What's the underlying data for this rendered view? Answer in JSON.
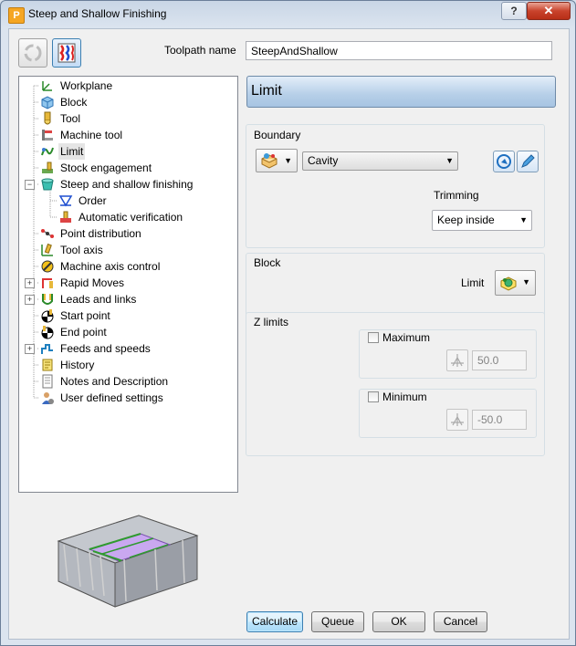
{
  "window": {
    "title": "Steep and Shallow Finishing",
    "help_label": "?",
    "close_label": "✕",
    "app_icon_letter": "P"
  },
  "header": {
    "toolpath_name_label": "Toolpath name",
    "toolpath_name_value": "SteepAndShallow"
  },
  "tree": {
    "items": [
      {
        "label": "Workplane",
        "icon": "workplane-icon"
      },
      {
        "label": "Block",
        "icon": "block-icon"
      },
      {
        "label": "Tool",
        "icon": "tool-icon"
      },
      {
        "label": "Machine tool",
        "icon": "machine-tool-icon"
      },
      {
        "label": "Limit",
        "icon": "limit-icon",
        "selected": true
      },
      {
        "label": "Stock engagement",
        "icon": "stock-engagement-icon"
      },
      {
        "label": "Steep and shallow finishing",
        "icon": "steep-shallow-icon",
        "expanded": true
      },
      {
        "label": "Order",
        "icon": "order-icon",
        "child": true
      },
      {
        "label": "Automatic verification",
        "icon": "verification-icon",
        "child": true
      },
      {
        "label": "Point distribution",
        "icon": "point-distribution-icon"
      },
      {
        "label": "Tool axis",
        "icon": "tool-axis-icon"
      },
      {
        "label": "Machine axis control",
        "icon": "machine-axis-icon"
      },
      {
        "label": "Rapid Moves",
        "icon": "rapid-moves-icon",
        "collapsed": true
      },
      {
        "label": "Leads and links",
        "icon": "leads-links-icon",
        "collapsed": true
      },
      {
        "label": "Start point",
        "icon": "start-point-icon"
      },
      {
        "label": "End point",
        "icon": "end-point-icon"
      },
      {
        "label": "Feeds and speeds",
        "icon": "feeds-speeds-icon",
        "collapsed": true
      },
      {
        "label": "History",
        "icon": "history-icon"
      },
      {
        "label": "Notes and Description",
        "icon": "notes-icon"
      },
      {
        "label": "User defined settings",
        "icon": "user-settings-icon"
      }
    ]
  },
  "panel": {
    "title": "Limit",
    "boundary": {
      "title": "Boundary",
      "selected": "Cavity",
      "trimming_label": "Trimming",
      "trimming_value": "Keep inside"
    },
    "block": {
      "title": "Block",
      "limit_label": "Limit"
    },
    "zlimits": {
      "title": "Z limits",
      "maximum_label": "Maximum",
      "maximum_value": "50.0",
      "minimum_label": "Minimum",
      "minimum_value": "-50.0"
    }
  },
  "buttons": {
    "calculate": "Calculate",
    "queue": "Queue",
    "ok": "OK",
    "cancel": "Cancel"
  },
  "colors": {
    "selection": "#3399ff",
    "panel_header": "#b6cfe8",
    "preview_face": "#c9a8f0"
  }
}
